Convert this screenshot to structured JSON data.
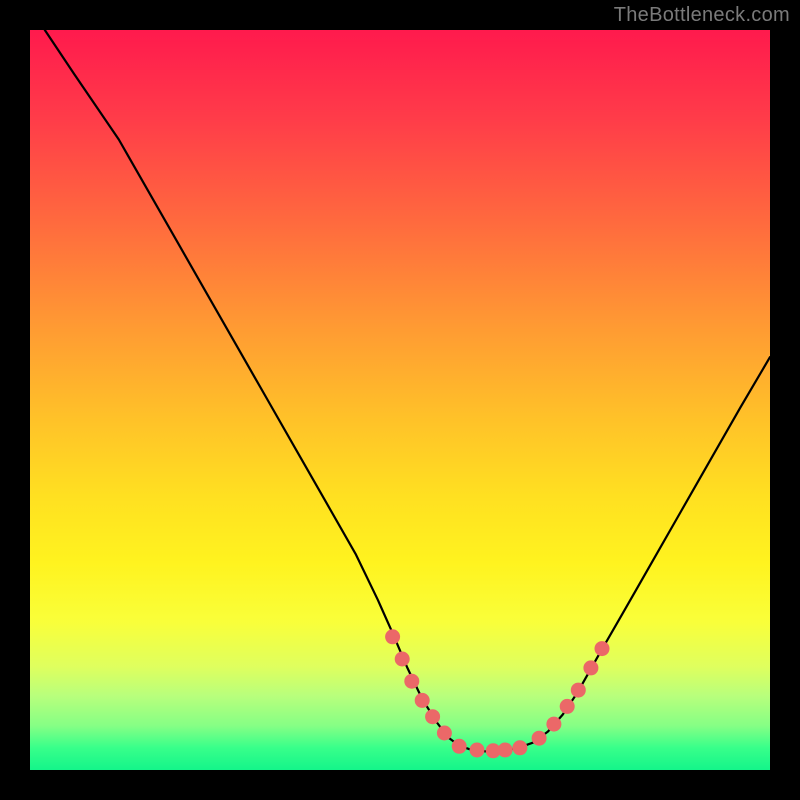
{
  "attribution": "TheBottleneck.com",
  "colors": {
    "dot": "#eb6868",
    "curve": "#000000"
  },
  "chart_data": {
    "type": "line",
    "title": "",
    "xlabel": "",
    "ylabel": "",
    "xlim": [
      0,
      100
    ],
    "ylim": [
      0,
      100
    ],
    "curve": [
      {
        "x": 2.0,
        "y": 100.0
      },
      {
        "x": 6.0,
        "y": 94.0
      },
      {
        "x": 12.0,
        "y": 85.2
      },
      {
        "x": 16.0,
        "y": 78.2
      },
      {
        "x": 20.0,
        "y": 71.2
      },
      {
        "x": 24.0,
        "y": 64.2
      },
      {
        "x": 28.0,
        "y": 57.2
      },
      {
        "x": 32.0,
        "y": 50.2
      },
      {
        "x": 36.0,
        "y": 43.2
      },
      {
        "x": 40.0,
        "y": 36.2
      },
      {
        "x": 44.0,
        "y": 29.2
      },
      {
        "x": 47.0,
        "y": 23.0
      },
      {
        "x": 49.0,
        "y": 18.5
      },
      {
        "x": 51.0,
        "y": 13.8
      },
      {
        "x": 53.0,
        "y": 9.6
      },
      {
        "x": 55.0,
        "y": 6.4
      },
      {
        "x": 56.5,
        "y": 4.4
      },
      {
        "x": 58.0,
        "y": 3.3
      },
      {
        "x": 60.0,
        "y": 2.6
      },
      {
        "x": 62.0,
        "y": 2.5
      },
      {
        "x": 64.0,
        "y": 2.6
      },
      {
        "x": 66.0,
        "y": 3.0
      },
      {
        "x": 68.0,
        "y": 3.7
      },
      {
        "x": 70.0,
        "y": 5.2
      },
      {
        "x": 72.0,
        "y": 7.5
      },
      {
        "x": 74.0,
        "y": 10.5
      },
      {
        "x": 77.0,
        "y": 15.8
      },
      {
        "x": 80.0,
        "y": 21.0
      },
      {
        "x": 84.0,
        "y": 28.0
      },
      {
        "x": 88.0,
        "y": 35.0
      },
      {
        "x": 92.0,
        "y": 42.0
      },
      {
        "x": 96.0,
        "y": 49.0
      },
      {
        "x": 100.0,
        "y": 55.8
      }
    ],
    "dots": [
      {
        "x": 49.0,
        "y": 18.0
      },
      {
        "x": 50.3,
        "y": 15.0
      },
      {
        "x": 51.6,
        "y": 12.0
      },
      {
        "x": 53.0,
        "y": 9.4
      },
      {
        "x": 54.4,
        "y": 7.2
      },
      {
        "x": 56.0,
        "y": 5.0
      },
      {
        "x": 58.0,
        "y": 3.2
      },
      {
        "x": 60.4,
        "y": 2.7
      },
      {
        "x": 62.6,
        "y": 2.6
      },
      {
        "x": 64.2,
        "y": 2.7
      },
      {
        "x": 66.2,
        "y": 3.0
      },
      {
        "x": 68.8,
        "y": 4.3
      },
      {
        "x": 70.8,
        "y": 6.2
      },
      {
        "x": 72.6,
        "y": 8.6
      },
      {
        "x": 74.1,
        "y": 10.8
      },
      {
        "x": 75.8,
        "y": 13.8
      },
      {
        "x": 77.3,
        "y": 16.4
      }
    ]
  }
}
